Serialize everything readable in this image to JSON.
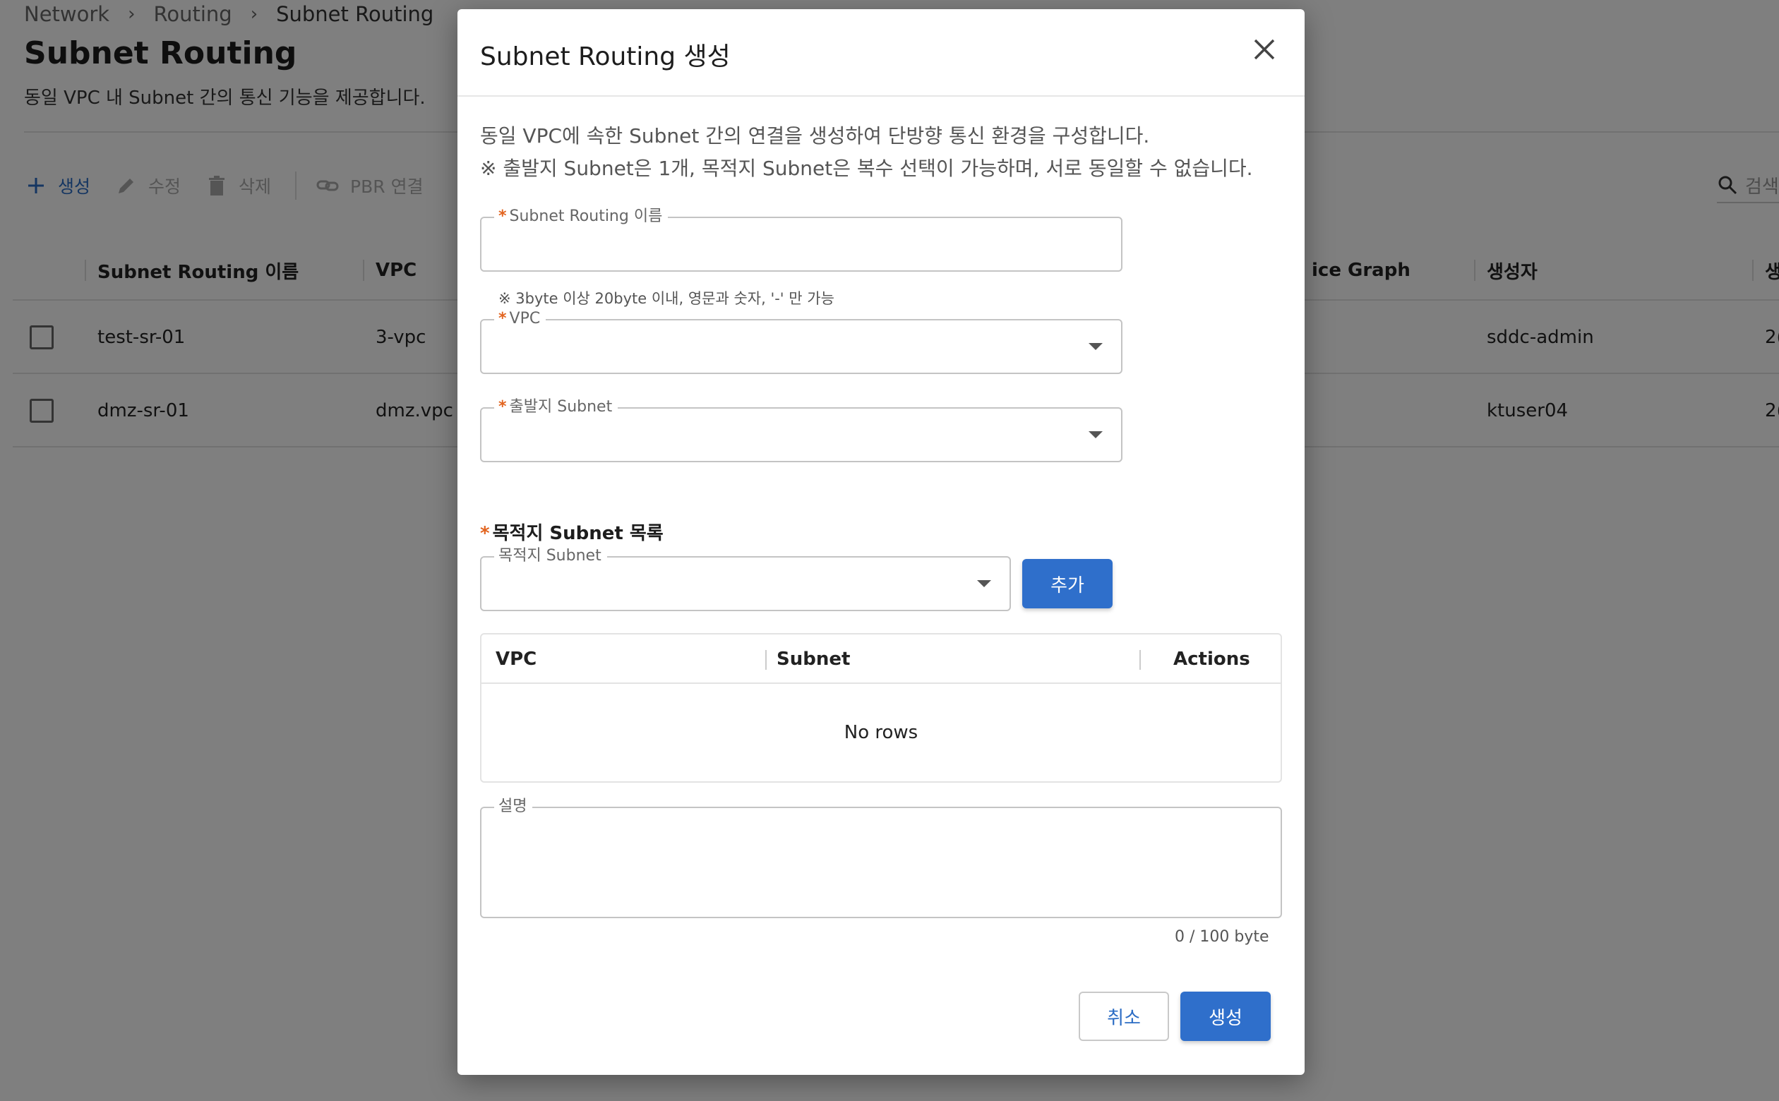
{
  "breadcrumb": {
    "items": [
      "Network",
      "Routing",
      "Subnet Routing"
    ]
  },
  "page": {
    "title": "Subnet Routing",
    "description": "동일 VPC 내 Subnet 간의 통신 기능을 제공합니다."
  },
  "toolbar": {
    "create_label": "생성",
    "edit_label": "수정",
    "delete_label": "삭제",
    "pbr_label": "PBR 연결",
    "search_placeholder": "검색"
  },
  "grid": {
    "columns": [
      "Subnet Routing 이름",
      "VPC",
      "ice Graph",
      "생성자",
      "생"
    ],
    "rows": [
      {
        "name": "test-sr-01",
        "vpc": "3-vpc",
        "creator": "sddc-admin",
        "date": "2("
      },
      {
        "name": "dmz-sr-01",
        "vpc": "dmz.vpc",
        "creator": "ktuser04",
        "date": "2("
      }
    ]
  },
  "modal": {
    "title": "Subnet Routing 생성",
    "info_line1": "동일 VPC에 속한 Subnet 간의 연결을 생성하여 단방향 통신 환경을 구성합니다.",
    "info_line2": "※ 출발지 Subnet은 1개, 목적지 Subnet은 복수 선택이 가능하며, 서로 동일할 수 없습니다.",
    "name_field": {
      "label": "Subnet Routing 이름",
      "value": "",
      "hint": "※ 3byte 이상 20byte 이내, 영문과 숫자, '-' 만 가능"
    },
    "vpc_field": {
      "label": "VPC",
      "value": ""
    },
    "source_field": {
      "label": "출발지 Subnet",
      "value": ""
    },
    "dest_section_label": "목적지 Subnet 목록",
    "dest_field": {
      "label": "목적지 Subnet",
      "value": ""
    },
    "add_label": "추가",
    "dest_table": {
      "columns": [
        "VPC",
        "Subnet",
        "Actions"
      ],
      "empty_text": "No rows"
    },
    "desc_field": {
      "label": "설명",
      "value": "",
      "counter": "0 / 100 byte"
    },
    "cancel_label": "취소",
    "create_label": "생성"
  },
  "colors": {
    "primary": "#2f6fcb",
    "required": "#e2641f",
    "overlay": "rgba(0,0,0,0.5)"
  },
  "icons": [
    "plus-icon",
    "pencil-icon",
    "trash-icon",
    "link-icon",
    "search-icon",
    "close-icon",
    "chevron-down-icon"
  ]
}
